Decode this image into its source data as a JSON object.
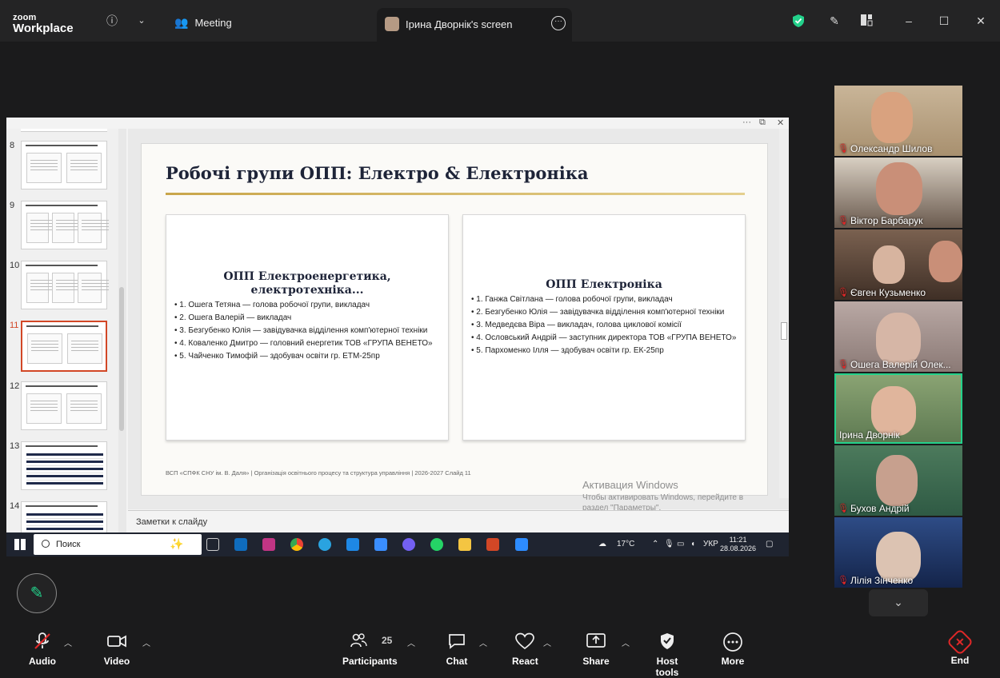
{
  "app": {
    "logo_line1": "zoom",
    "logo_line2": "Workplace"
  },
  "header": {
    "meeting_label": "Meeting",
    "share_tab_title": "Ірина Дворнік's screen",
    "security_color": "#23d18b"
  },
  "ppt": {
    "thumbnails": [
      {
        "num": "8",
        "layout": "two-box"
      },
      {
        "num": "9",
        "layout": "three-box"
      },
      {
        "num": "10",
        "layout": "three-box"
      },
      {
        "num": "11",
        "layout": "two-box",
        "selected": true
      },
      {
        "num": "12",
        "layout": "two-box"
      },
      {
        "num": "13",
        "layout": "table"
      },
      {
        "num": "14",
        "layout": "table"
      }
    ],
    "slide": {
      "title": "Робочі групи ОПП: Електро & Електроніка",
      "left_card": {
        "heading": "ОПП Електроенергетика, електротехніка...",
        "items": [
          "• 1. Ошега Тетяна — голова робочої групи, викладач",
          "• 2. Ошега Валерій — викладач",
          "• 3. Безгубенко Юлія — завідувачка відділення комп'ютерної техніки",
          "• 4. Коваленко Дмитро — головний енергетик ТОВ «ГРУПА ВЕНЕТО»",
          "• 5. Чайченко Тимофій — здобувач освіти гр. ЕТМ-25пр"
        ]
      },
      "right_card": {
        "heading": "ОПП Електроніка",
        "items": [
          "• 1. Ганжа Світлана — голова робочої групи, викладач",
          "• 2. Безгубенко Юлія — завідувачка відділення комп'ютерної техніки",
          "• 3. Медведєва Віра — викладач, голова циклової комісії",
          "• 4. Ословський Андрій — заступник директора ТОВ «ГРУПА ВЕНЕТО»",
          "• 5. Пархоменко Ілля — здобувач освіти гр. ЕК-25пр"
        ]
      },
      "footer": "ВСП «СПФК СНУ ім. В. Даля»  |  Організація освітнього процесу та структура управління  |  2026-2027     Слайд 11"
    },
    "notes_placeholder": "Заметки к слайду",
    "activation": {
      "title": "Активация Windows",
      "text": "Чтобы активировать Windows, перейдите в раздел \"Параметры\"."
    }
  },
  "taskbar": {
    "search_label": "Поиск",
    "weather": "17°C",
    "lang": "УКР",
    "time": "11:21",
    "date": "28.08.2026"
  },
  "participants_tiles": [
    {
      "name": "Олександр Шилов",
      "muted": true
    },
    {
      "name": "Віктор Барбарук",
      "muted": true
    },
    {
      "name": "Євген Кузьменко",
      "muted": true
    },
    {
      "name": "Ошега Валерій Олек...",
      "muted": true
    },
    {
      "name": "Ірина Дворнік",
      "muted": false,
      "active": true
    },
    {
      "name": "Бухов Андрій",
      "muted": true
    },
    {
      "name": "Лілія Зінченко",
      "muted": true
    }
  ],
  "toolbar": {
    "audio": "Audio",
    "video": "Video",
    "participants": "Participants",
    "participants_count": "25",
    "chat": "Chat",
    "react": "React",
    "share": "Share",
    "host_tools": "Host tools",
    "more": "More",
    "end": "End"
  }
}
